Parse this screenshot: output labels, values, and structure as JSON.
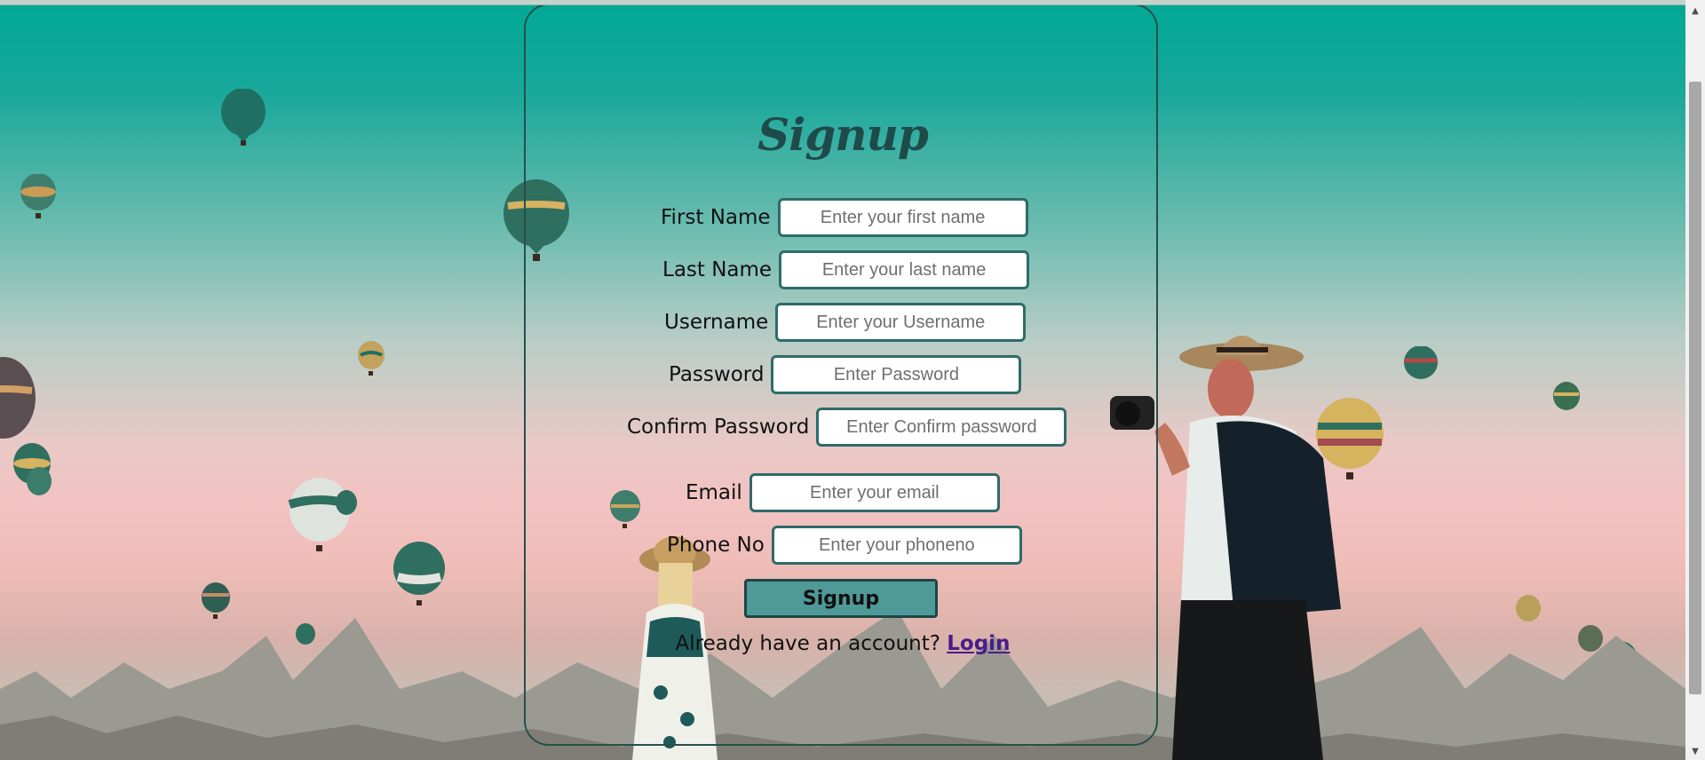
{
  "form": {
    "title": "Signup",
    "fields": [
      {
        "label": "First Name",
        "placeholder": "Enter your first name"
      },
      {
        "label": "Last Name",
        "placeholder": "Enter your last name"
      },
      {
        "label": "Username",
        "placeholder": "Enter your Username"
      },
      {
        "label": "Password",
        "placeholder": "Enter Password"
      },
      {
        "label": "Confirm Password",
        "placeholder": "Enter Confirm password"
      },
      {
        "label": "Email",
        "placeholder": "Enter your email"
      },
      {
        "label": "Phone No",
        "placeholder": "Enter your phoneno"
      }
    ],
    "submit_label": "Signup",
    "account_text": "Already have an account?",
    "login_link": "Login"
  },
  "colors": {
    "accent": "#4f9a98",
    "border": "#2e6b6a",
    "link": "#4b1b8a",
    "sky_top": "#00a896"
  },
  "scrollbar": {
    "up_icon": "chevron-up-icon",
    "down_icon": "chevron-down-icon"
  }
}
